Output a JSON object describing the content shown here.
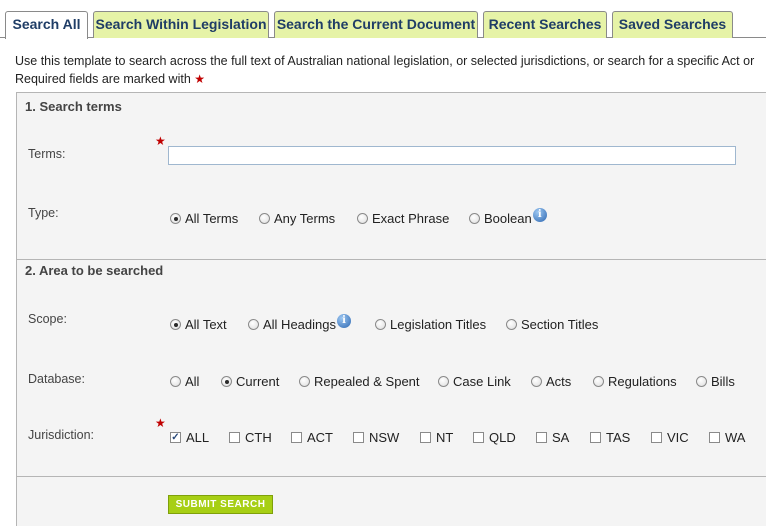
{
  "tabs": [
    {
      "label": "Search All",
      "active": true
    },
    {
      "label": "Search Within Legislation",
      "active": false
    },
    {
      "label": "Search the Current Document",
      "active": false
    },
    {
      "label": "Recent Searches",
      "active": false
    },
    {
      "label": "Saved Searches",
      "active": false
    }
  ],
  "intro": {
    "line1": "Use this template to search across the full text of Australian national legislation, or selected jurisdictions, or search for a specific Act or",
    "line2": "Required fields are marked with",
    "required_marker": "★"
  },
  "section1": {
    "title": "1. Search terms",
    "terms_label": "Terms:",
    "terms_value": "",
    "type_label": "Type:",
    "type_options": [
      "All Terms",
      "Any Terms",
      "Exact Phrase",
      "Boolean"
    ],
    "type_selected": "All Terms"
  },
  "section2": {
    "title": "2. Area to be searched",
    "scope_label": "Scope:",
    "scope_options": [
      "All Text",
      "All Headings",
      "Legislation Titles",
      "Section Titles"
    ],
    "scope_selected": "All Text",
    "database_label": "Database:",
    "database_options": [
      "All",
      "Current",
      "Repealed & Spent",
      "Case Link",
      "Acts",
      "Regulations",
      "Bills"
    ],
    "database_selected": "Current",
    "jurisdiction_label": "Jurisdiction:",
    "jurisdiction_options": [
      "ALL",
      "CTH",
      "ACT",
      "NSW",
      "NT",
      "QLD",
      "SA",
      "TAS",
      "VIC",
      "WA"
    ],
    "jurisdiction_checked": [
      "ALL"
    ]
  },
  "submit_label": "SUBMIT SEARCH",
  "icons": {
    "info": "info-icon",
    "required": "required-star-icon"
  },
  "colors": {
    "tab_bg": "#e6f3a7",
    "tab_text": "#1f3d66",
    "submit_bg": "#a7cf14",
    "required": "#c00000"
  }
}
